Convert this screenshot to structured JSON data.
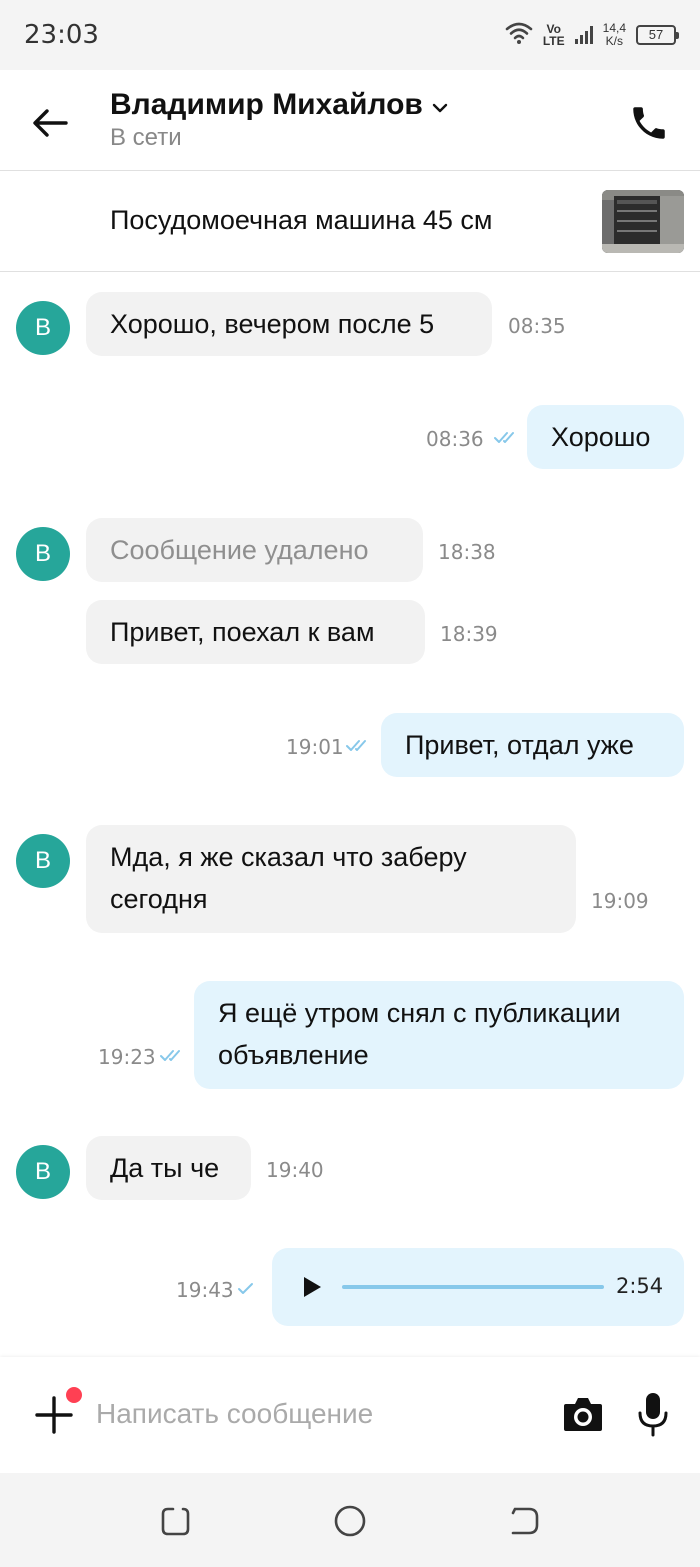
{
  "status_bar": {
    "time": "23:03",
    "volte_top": "Vo",
    "volte_bottom": "LTE",
    "speed_top": "14,4",
    "speed_bottom": "K/s",
    "battery": "57",
    "icons": [
      "wifi-icon",
      "volte-icon",
      "signal-icon",
      "battery-icon"
    ]
  },
  "header": {
    "contact_name": "Владимир Михайлов",
    "status": "В сети",
    "icons": [
      "back-arrow-icon",
      "chevron-down-icon",
      "phone-icon"
    ]
  },
  "listing": {
    "title": "Посудомоечная машина 45 см"
  },
  "messages": [
    {
      "direction": "in",
      "avatar": "В",
      "text": "Хорошо, вечером после 5",
      "time": "08:35"
    },
    {
      "direction": "out",
      "text": "Хорошо",
      "time": "08:36",
      "status": "read"
    },
    {
      "direction": "in",
      "avatar": "В",
      "text": "Сообщение удалено",
      "time": "18:38",
      "deleted": true
    },
    {
      "direction": "in",
      "text": "Привет, поехал к вам",
      "time": "18:39"
    },
    {
      "direction": "out",
      "text": "Привет, отдал уже",
      "time": "19:01",
      "status": "read"
    },
    {
      "direction": "in",
      "avatar": "В",
      "text_line1": "Мда, я же сказал что заберу",
      "text_line2": "сегодня",
      "time": "19:09"
    },
    {
      "direction": "out",
      "text_line1": "Я ещё утром снял с публикации",
      "text_line2": "объявление",
      "time": "19:23",
      "status": "read"
    },
    {
      "direction": "in",
      "avatar": "В",
      "text": "Да ты че",
      "time": "19:40"
    },
    {
      "direction": "out",
      "type": "voice",
      "duration": "2:54",
      "time": "19:43",
      "status": "delivered"
    }
  ],
  "composer": {
    "placeholder": "Написать сообщение",
    "value": "",
    "icons": [
      "plus-icon",
      "camera-icon",
      "microphone-icon"
    ]
  },
  "colors": {
    "avatar": "#26a69a",
    "incoming_bubble": "#f2f2f2",
    "outgoing_bubble": "#e3f4fd",
    "read_ticks": "#87c8ea",
    "notification_dot": "#ff4053"
  },
  "navigation_bar": {
    "icons": [
      "recent-apps-icon",
      "home-icon",
      "back-icon"
    ]
  }
}
